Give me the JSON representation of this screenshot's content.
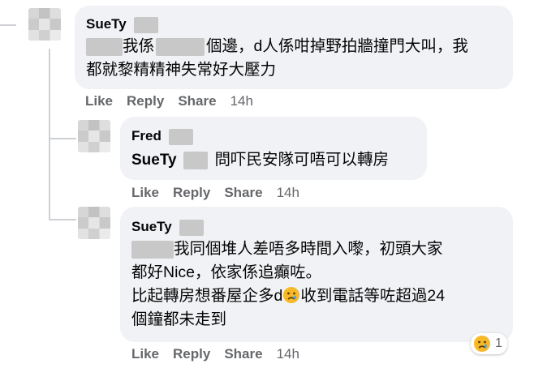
{
  "comments": [
    {
      "author": "SueTy",
      "lines": [
        "我係",
        "個邊，d人係咁掉野拍牆撞門大叫，我",
        "都就黎精精神失常好大壓力"
      ],
      "actions": {
        "like": "Like",
        "reply": "Reply",
        "share": "Share",
        "time": "14h"
      }
    },
    {
      "author": "Fred",
      "mention": "SueTy",
      "text": "問吓民安隊可唔可以轉房",
      "actions": {
        "like": "Like",
        "reply": "Reply",
        "share": "Share",
        "time": "14h"
      }
    },
    {
      "author": "SueTy",
      "lines": [
        "我同個堆人差唔多時間入嚟，初頭大家",
        "都好Nice，依家係追癲咗。",
        "比起轉房想番屋企多d",
        "收到電話等咗超過24",
        "個鐘都未走到"
      ],
      "reaction_count": "1",
      "reaction_icon": "sad-face-icon",
      "actions": {
        "like": "Like",
        "reply": "Reply",
        "share": "Share",
        "time": "14h"
      }
    }
  ]
}
